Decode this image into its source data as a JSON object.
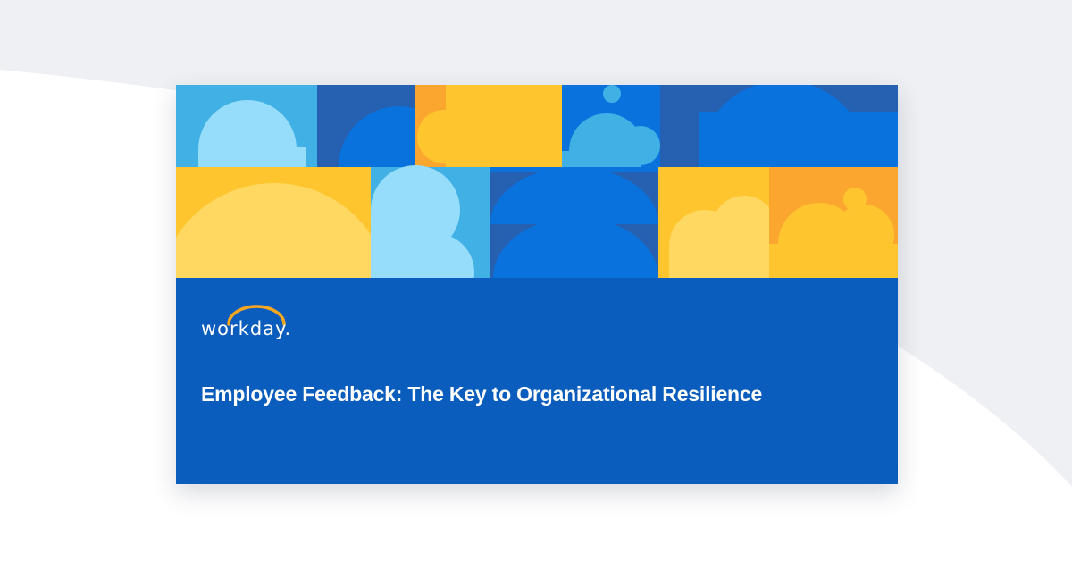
{
  "brand": {
    "name": "workday.",
    "logo_icon": "arc-logo-icon"
  },
  "headline": "Employee Feedback: The Key to Organizational Resilience",
  "colors": {
    "page_background": "#eef0f3",
    "panel_blue": "#0a5dbc",
    "logo_arc": "#f5a623",
    "text": "#ffffff"
  }
}
